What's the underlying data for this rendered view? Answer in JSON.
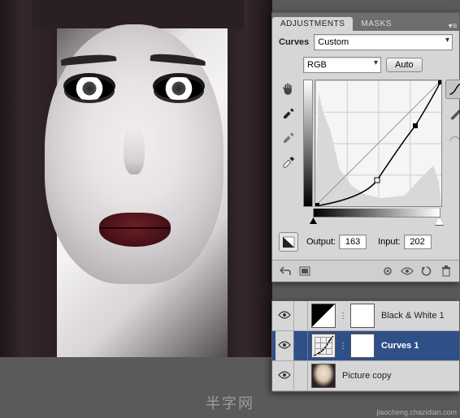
{
  "tabs": {
    "adjustments": "ADJUSTMENTS",
    "masks": "MASKS"
  },
  "panel": {
    "title": "Curves",
    "preset": "Custom",
    "channel": "RGB",
    "auto_label": "Auto",
    "output_label": "Output:",
    "input_label": "Input:",
    "output_value": "163",
    "input_value": "202"
  },
  "chart_data": {
    "type": "line",
    "title": "Curves",
    "xlabel": "Input",
    "ylabel": "Output",
    "xlim": [
      0,
      255
    ],
    "ylim": [
      0,
      255
    ],
    "series": [
      {
        "name": "baseline",
        "x": [
          0,
          255
        ],
        "y": [
          0,
          255
        ]
      },
      {
        "name": "curve",
        "points": [
          {
            "input": 0,
            "output": 0
          },
          {
            "input": 125,
            "output": 52
          },
          {
            "input": 202,
            "output": 163
          },
          {
            "input": 255,
            "output": 255
          }
        ]
      }
    ],
    "histogram_peaks": [
      {
        "x": 10,
        "h": 0.95
      },
      {
        "x": 20,
        "h": 0.7
      },
      {
        "x": 40,
        "h": 0.3
      },
      {
        "x": 60,
        "h": 0.15
      },
      {
        "x": 100,
        "h": 0.08
      },
      {
        "x": 150,
        "h": 0.1
      },
      {
        "x": 200,
        "h": 0.25
      },
      {
        "x": 230,
        "h": 0.35
      },
      {
        "x": 250,
        "h": 0.2
      }
    ]
  },
  "layers": [
    {
      "name": "Black & White 1",
      "visible": true,
      "type": "adj-bw",
      "selected": false
    },
    {
      "name": "Curves 1",
      "visible": true,
      "type": "adj-curves",
      "selected": true
    },
    {
      "name": "Picture copy",
      "visible": true,
      "type": "img",
      "selected": false
    }
  ],
  "watermark": "半字网",
  "watermark_url": "jiaocheng.chazidian.com"
}
